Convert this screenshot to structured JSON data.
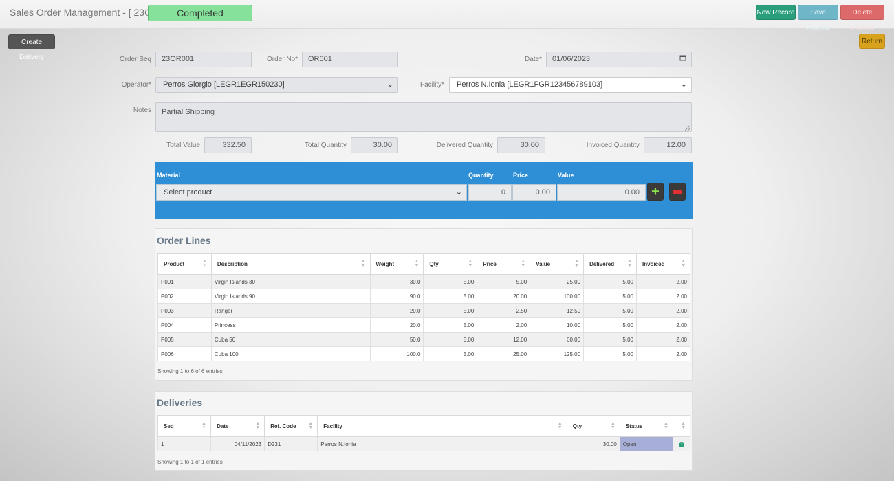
{
  "header": {
    "title": "Sales Order Management - [  23OR001 ]",
    "status": "Completed",
    "buttons": {
      "new": "New Record",
      "save": "Save Record",
      "delete": "Delete Record",
      "create_delivery": "Create Delivery",
      "return": "Return"
    }
  },
  "form": {
    "order_seq": {
      "label": "Order Seq",
      "value": "23OR001"
    },
    "order_no": {
      "label": "Order No*",
      "value": "OR001"
    },
    "date": {
      "label": "Date*",
      "value": "01/06/2023"
    },
    "operator": {
      "label": "Operator*",
      "value": "Perros Giorgio [LEGR1EGR150230]"
    },
    "facility": {
      "label": "Facility*",
      "value": "Perros N.Ionia [LEGR1FGR123456789103]"
    },
    "notes": {
      "label": "Notes",
      "value": "Partial Shipping"
    },
    "total_value": {
      "label": "Total Value",
      "value": "332.50"
    },
    "total_quantity": {
      "label": "Total Quantity",
      "value": "30.00"
    },
    "delivered_quantity": {
      "label": "Delivered Quantity",
      "value": "30.00"
    },
    "invoiced_quantity": {
      "label": "Invoiced Quantity",
      "value": "12.00"
    }
  },
  "line_entry": {
    "material_label": "Material",
    "quantity_label": "Quantity",
    "price_label": "Price",
    "value_label": "Value",
    "material_value": "Select product",
    "quantity_value": "0",
    "price_value": "0.00",
    "value_value": "0.00"
  },
  "order_lines": {
    "title": "Order Lines",
    "columns": [
      "Product",
      "Description",
      "Weight",
      "Qty",
      "Price",
      "Value",
      "Delivered",
      "Invoiced"
    ],
    "rows": [
      [
        "P001",
        "Virgin Islands 30",
        "30.0",
        "5.00",
        "5.00",
        "25.00",
        "5.00",
        "2.00"
      ],
      [
        "P002",
        "Virgin Islands 90",
        "90.0",
        "5.00",
        "20.00",
        "100.00",
        "5.00",
        "2.00"
      ],
      [
        "P003",
        "Ranger",
        "20.0",
        "5.00",
        "2.50",
        "12.50",
        "5.00",
        "2.00"
      ],
      [
        "P004",
        "Princess",
        "20.0",
        "5.00",
        "2.00",
        "10.00",
        "5.00",
        "2.00"
      ],
      [
        "P005",
        "Cuba 50",
        "50.0",
        "5.00",
        "12.00",
        "60.00",
        "5.00",
        "2.00"
      ],
      [
        "P006",
        "Cuba 100",
        "100.0",
        "5.00",
        "25.00",
        "125.00",
        "5.00",
        "2.00"
      ]
    ],
    "info": "Showing 1 to 6 of 6 entries"
  },
  "deliveries": {
    "title": "Deliveries",
    "columns": [
      "Seq",
      "Date",
      "Ref. Code",
      "Facility",
      "Qty",
      "Status",
      ""
    ],
    "rows": [
      [
        "1",
        "04/11/2023",
        "D231",
        "Perros N.Ionia",
        "30.00",
        "Open"
      ]
    ],
    "info": "Showing 1 to 1 of 1 entries"
  },
  "icons": {
    "calendar": "calendar-icon",
    "add": "plus-icon",
    "remove": "minus-icon",
    "open_row": "arrow-circle-icon"
  },
  "colors": {
    "status_completed": "#86e29b",
    "new_record": "#2a9d7a",
    "save_record": "#6fb6c9",
    "delete_record": "#dd6a6a",
    "return": "#d8a21d",
    "line_entry_panel": "#2f8fd6"
  }
}
